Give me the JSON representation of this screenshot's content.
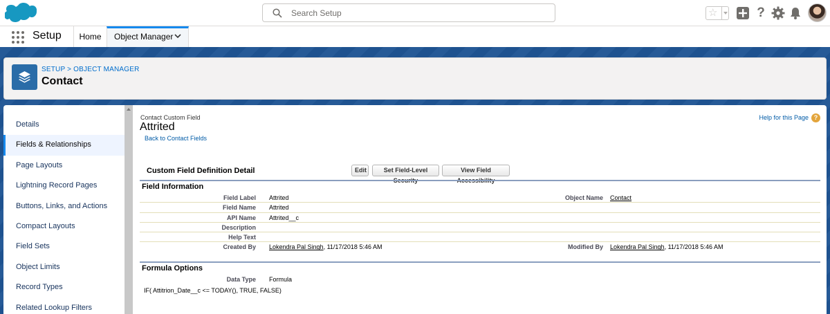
{
  "header": {
    "search_placeholder": "Search Setup",
    "help_glyph": "?",
    "star_glyph": "☆",
    "icons": [
      "salesforce-cloud-icon",
      "search-icon",
      "star-icon",
      "add-icon",
      "help-icon",
      "gear-icon",
      "bell-icon",
      "avatar"
    ]
  },
  "nav": {
    "app_name": "Setup",
    "tabs": [
      {
        "label": "Home"
      },
      {
        "label": "Object Manager"
      }
    ]
  },
  "object_header": {
    "breadcrumb": "SETUP > OBJECT MANAGER",
    "title": "Contact"
  },
  "sidebar": {
    "items": [
      {
        "label": "Details"
      },
      {
        "label": "Fields & Relationships",
        "active": true
      },
      {
        "label": "Page Layouts"
      },
      {
        "label": "Lightning Record Pages"
      },
      {
        "label": "Buttons, Links, and Actions"
      },
      {
        "label": "Compact Layouts"
      },
      {
        "label": "Field Sets"
      },
      {
        "label": "Object Limits"
      },
      {
        "label": "Record Types"
      },
      {
        "label": "Related Lookup Filters"
      }
    ]
  },
  "content": {
    "eyebrow": "Contact Custom Field",
    "title": "Attrited",
    "back_link": "Back to Contact Fields",
    "help_link": "Help for this Page",
    "help_badge": "?",
    "section_title": "Custom Field Definition Detail",
    "buttons": {
      "edit": "Edit",
      "field_level_security": "Set Field-Level Security",
      "field_accessibility": "View Field Accessibility"
    },
    "field_info": {
      "title": "Field Information",
      "rows": [
        {
          "label": "Field Label",
          "value": "Attrited",
          "label2": "Object Name",
          "value2": "Contact"
        },
        {
          "label": "Field Name",
          "value": "Attrited"
        },
        {
          "label": "API Name",
          "value": "Attrited__c"
        },
        {
          "label": "Description",
          "value": ""
        },
        {
          "label": "Help Text",
          "value": ""
        },
        {
          "label": "Created By",
          "value_user": "Lokendra Pal Singh",
          "value_date": ", 11/17/2018 5:46 AM",
          "label2": "Modified By",
          "value2_user": "Lokendra Pal Singh",
          "value2_date": ", 11/17/2018 5:46 AM"
        }
      ]
    },
    "formula_options": {
      "title": "Formula Options",
      "data_type_label": "Data Type",
      "data_type_value": "Formula",
      "formula": "IF( Attitrion_Date__c <= TODAY(), TRUE, FALSE)"
    }
  },
  "colors": {
    "brand_band": "#1f5594",
    "accent": "#1589ee",
    "object_icon": "#2a6ca8",
    "link": "#015ba7"
  }
}
